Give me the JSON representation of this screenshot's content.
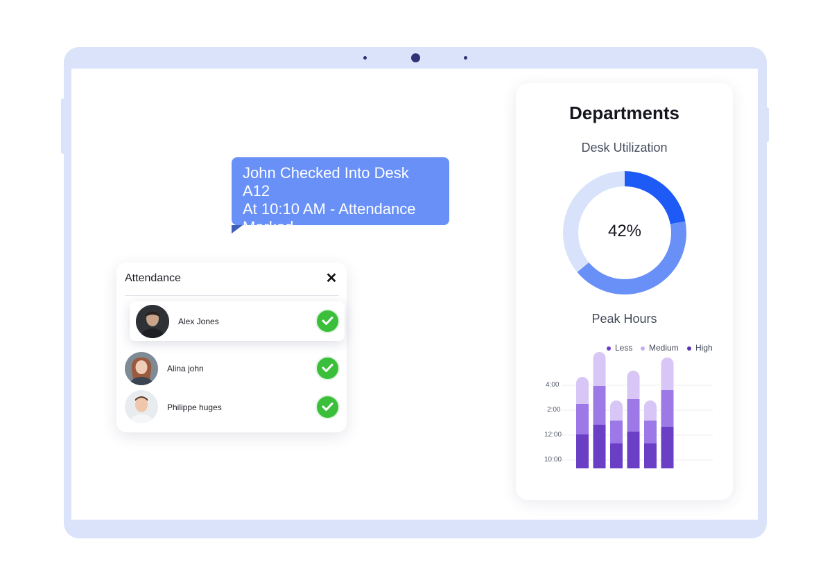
{
  "notification": {
    "lines": [
      "John Checked Into Desk A12",
      "At 10:10 AM - Attendance",
      "Marked"
    ]
  },
  "attendance": {
    "title": "Attendance",
    "close_icon": "close-icon",
    "people": [
      {
        "name": "Alex Jones",
        "status_icon": "check-icon",
        "highlighted": true
      },
      {
        "name": "Alina john",
        "status_icon": "check-icon",
        "highlighted": false
      },
      {
        "name": "Philippe huges",
        "status_icon": "check-icon",
        "highlighted": false
      }
    ]
  },
  "departments": {
    "title": "Departments",
    "desk_utilization": {
      "title": "Desk Utilization",
      "value_label": "42%"
    },
    "peak_hours": {
      "title": "Peak Hours"
    }
  },
  "colors": {
    "bubble": "#6890f7",
    "check": "#3bbf3b",
    "donut_dark": "#1e5af5",
    "donut_mid": "#6890f7",
    "donut_track": "#d8e2fb",
    "less": "#6a3fc6",
    "medium": "#9c79e6",
    "high": "#d7c6f6"
  },
  "chart_data": [
    {
      "type": "pie",
      "title": "Desk Utilization",
      "center_label": "42%",
      "values": [
        22,
        42,
        36
      ]
    },
    {
      "type": "bar",
      "title": "Peak Hours",
      "stacked": true,
      "categories": [
        "",
        "",
        "",
        "",
        "",
        ""
      ],
      "y_ticks": [
        "4:00",
        "2:00",
        "12:00",
        "10:00"
      ],
      "legend": [
        "Less",
        "Medium",
        "High"
      ],
      "legend_position": "top-right",
      "grid": true,
      "series": [
        {
          "name": "Less",
          "values": [
            49,
            63,
            36,
            53,
            36,
            60
          ]
        },
        {
          "name": "Medium",
          "values": [
            44,
            56,
            33,
            47,
            33,
            53
          ]
        },
        {
          "name": "High",
          "values": [
            39,
            49,
            29,
            41,
            29,
            47
          ]
        }
      ]
    }
  ]
}
